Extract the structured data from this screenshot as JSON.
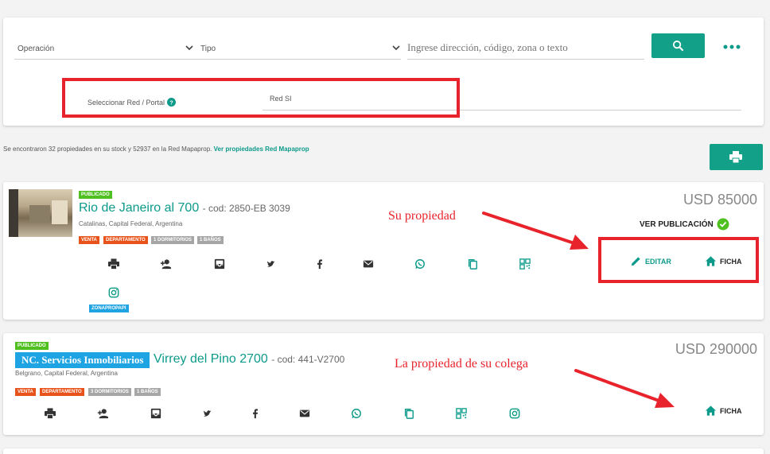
{
  "search": {
    "operacion_label": "Operación",
    "tipo_label": "Tipo",
    "placeholder": "Ingrese dirección, código, zona o texto",
    "red_label": "Seleccionar Red / Portal",
    "red_value": "Red SI"
  },
  "summary": {
    "text": "Se encontraron 32 propiedades en su stock y 52937 en la Red Mapaprop.",
    "link": "Ver propiedades Red Mapaprop"
  },
  "listings": [
    {
      "status": "PUBLICADO",
      "title": "Rio de Janeiro al 700",
      "code": "- cod: 2850-EB 3039",
      "location": "Catalinas, Capital Federal, Argentina",
      "tags": [
        "VENTA",
        "DEPARTAMENTO",
        "1 DORMITORIOS",
        "1 BAÑOS"
      ],
      "price": "USD 85000",
      "ver_publicacion": "VER PUBLICACIÓN",
      "editar": "EDITAR",
      "ficha": "FICHA",
      "portal_tag": "ZONAPROPAPI"
    },
    {
      "status": "PUBLICADO",
      "agency": "NC. Servicios Inmobiliarios",
      "title": "Virrey del Pino 2700",
      "code": "- cod: 441-V2700",
      "location": "Belgrano, Capital Federal, Argentina",
      "tags": [
        "VENTA",
        "DEPARTAMENTO",
        "3 DORMITORIOS",
        "1 BAÑOS"
      ],
      "price": "USD 290000",
      "ficha": "FICHA"
    }
  ],
  "annotations": {
    "own": "Su propiedad",
    "colleague": "La propiedad de su colega"
  },
  "colors": {
    "accent": "#13a089",
    "annotation": "#e8232c"
  }
}
